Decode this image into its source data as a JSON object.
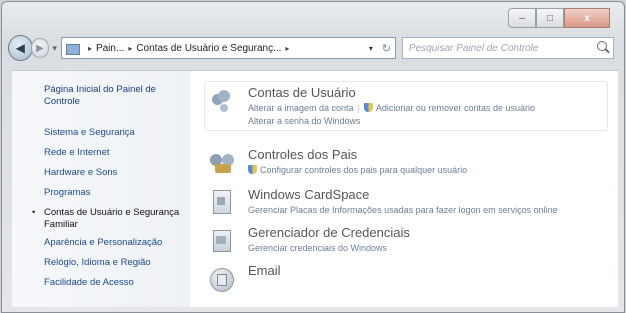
{
  "window": {
    "caption": {
      "minimize": "–",
      "maximize": "□",
      "close": "x"
    }
  },
  "nav": {
    "back_glyph": "◀",
    "forward_glyph": "▶",
    "dropdown_glyph": "▾",
    "breadcrumb": [
      "Pain...",
      "Contas de Usuário e Seguranç..."
    ],
    "separator": "▸",
    "address_dropdown": "▾",
    "refresh_glyph": "↻",
    "search_placeholder": "Pesquisar Painel de Controle"
  },
  "sidebar": {
    "home_link": "Página Inicial do Painel de Controle",
    "items": [
      {
        "label": "Sistema e Segurança"
      },
      {
        "label": "Rede e Internet"
      },
      {
        "label": "Hardware e Sons"
      },
      {
        "label": "Programas"
      },
      {
        "label": "Contas de Usuário e Segurança Familiar",
        "active": true
      },
      {
        "label": "Aparência e Personalização"
      },
      {
        "label": "Relógio, Idioma e Região"
      },
      {
        "label": "Facilidade de Acesso"
      }
    ]
  },
  "categories": [
    {
      "title": "Contas de Usuário",
      "icon": "users-icon",
      "links": [
        "Alterar a imagem da conta",
        "Adicionar ou remover contas de usuário",
        "Alterar a senha do Windows"
      ]
    },
    {
      "title": "Controles dos Pais",
      "icon": "family-icon",
      "links": [
        "Configurar controles dos pais para qualquer usuário"
      ]
    },
    {
      "title": "Windows CardSpace",
      "icon": "cardspace-icon",
      "links": [
        "Gerenciar Placas de Informações usadas para fazer logon em serviços online"
      ]
    },
    {
      "title": "Gerenciador de Credenciais",
      "icon": "credentials-icon",
      "links": [
        "Gerenciar credenciais do Windows"
      ]
    },
    {
      "title": "Email",
      "icon": "mail-icon",
      "links": []
    }
  ]
}
